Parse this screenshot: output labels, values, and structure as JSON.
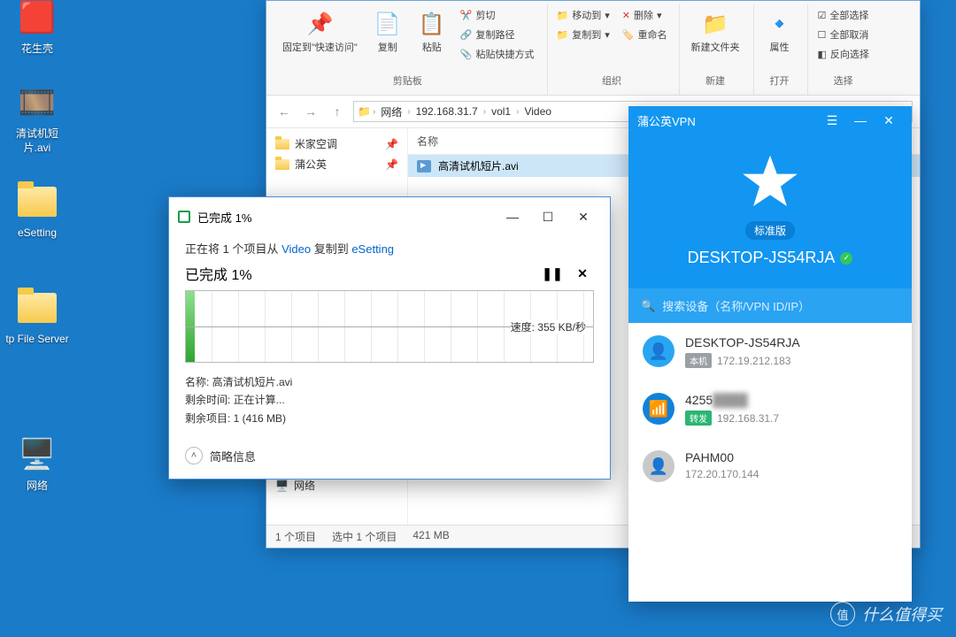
{
  "desktop": {
    "icons": [
      {
        "label": "花生壳"
      },
      {
        "label": "清试机短片.avi"
      },
      {
        "label": "eSetting"
      },
      {
        "label": "tp File Server"
      },
      {
        "label": "网络"
      }
    ]
  },
  "explorer": {
    "ribbon": {
      "pin": {
        "label": "固定到\"快速访问\""
      },
      "copy": "复制",
      "paste": "粘贴",
      "cut": "剪切",
      "copypath": "复制路径",
      "pasteshortcut": "粘贴快捷方式",
      "group_clipboard": "剪贴板",
      "moveto": "移动到",
      "copyto": "复制到",
      "delete": "删除",
      "rename": "重命名",
      "group_organize": "组织",
      "newfolder": "新建文件夹",
      "group_new": "新建",
      "properties": "属性",
      "group_open": "打开",
      "selectall": "全部选择",
      "selectnone": "全部取消",
      "invert": "反向选择",
      "group_select": "选择"
    },
    "breadcrumb": [
      "网络",
      "192.168.31.7",
      "vol1",
      "Video"
    ],
    "sidebar": [
      {
        "label": "米家空调"
      },
      {
        "label": "蒲公英"
      }
    ],
    "sidebar_network": "网络",
    "column_name": "名称",
    "file": "高清试机短片.avi",
    "status_items": "1 个项目",
    "status_selected": "选中 1 个项目",
    "status_size": "421 MB"
  },
  "copydlg": {
    "title": "已完成 1%",
    "line_prefix": "正在将 1 个项目从 ",
    "src": "Video",
    "mid": " 复制到 ",
    "dst": "eSetting",
    "progress_title": "已完成 1%",
    "speed": "速度: 355 KB/秒",
    "name_label": "名称: ",
    "name_value": "高清试机短片.avi",
    "remain_time_label": "剩余时间: ",
    "remain_time_value": "正在计算...",
    "remain_items_label": "剩余项目: ",
    "remain_items_value": "1 (416 MB)",
    "more": "简略信息"
  },
  "vpn": {
    "title": "蒲公英VPN",
    "edition": "标准版",
    "hostname": "DESKTOP-JS54RJA",
    "search_placeholder": "搜索设备（名称/VPN ID/IP）",
    "devices": [
      {
        "name": "DESKTOP-JS54RJA",
        "tag": "本机",
        "ip": "172.19.212.183",
        "avatar": "blue"
      },
      {
        "name": "4255",
        "tag": "转发",
        "ip": "192.168.31.7",
        "avatar": "router",
        "blurred": true
      },
      {
        "name": "PAHM00",
        "tag": "",
        "ip": "172.20.170.144",
        "avatar": "grey"
      }
    ]
  },
  "watermark": "什么值得买"
}
